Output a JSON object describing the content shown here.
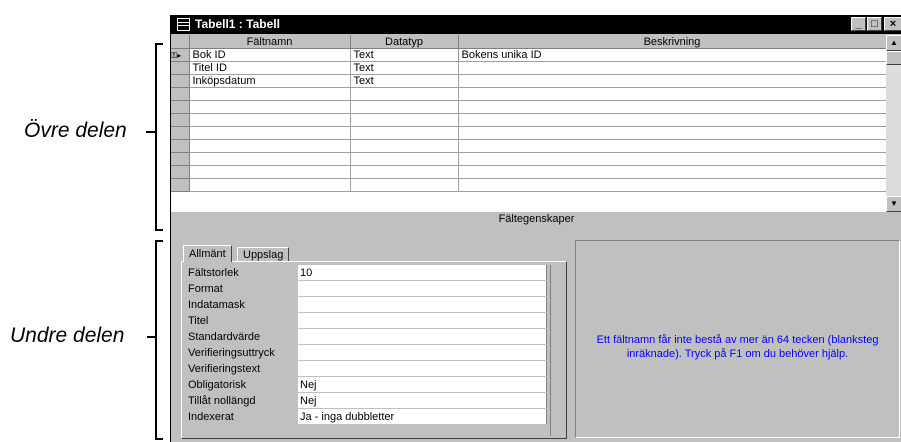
{
  "annotations": {
    "upper_label": "Övre delen",
    "lower_label": "Undre delen"
  },
  "window": {
    "title": "Tabell1 : Tabell",
    "title_icon": "table-icon",
    "minimize": "_",
    "maximize": "□",
    "close": "×"
  },
  "grid": {
    "columns": [
      "Fältnamn",
      "Datatyp",
      "Beskrivning"
    ],
    "rows": [
      {
        "name": "Bok ID",
        "type": "Text",
        "desc": "Bokens unika ID",
        "primary_key": true,
        "current": true
      },
      {
        "name": "Titel ID",
        "type": "Text",
        "desc": ""
      },
      {
        "name": "Inköpsdatum",
        "type": "Text",
        "desc": ""
      },
      {
        "name": "",
        "type": "",
        "desc": ""
      },
      {
        "name": "",
        "type": "",
        "desc": ""
      },
      {
        "name": "",
        "type": "",
        "desc": ""
      },
      {
        "name": "",
        "type": "",
        "desc": ""
      },
      {
        "name": "",
        "type": "",
        "desc": ""
      },
      {
        "name": "",
        "type": "",
        "desc": ""
      },
      {
        "name": "",
        "type": "",
        "desc": ""
      },
      {
        "name": "",
        "type": "",
        "desc": ""
      }
    ]
  },
  "properties_section_label": "Fältegenskaper",
  "tabs": [
    "Allmänt",
    "Uppslag"
  ],
  "properties": [
    {
      "label": "Fältstorlek",
      "value": "10"
    },
    {
      "label": "Format",
      "value": ""
    },
    {
      "label": "Indatamask",
      "value": ""
    },
    {
      "label": "Titel",
      "value": ""
    },
    {
      "label": "Standardvärde",
      "value": ""
    },
    {
      "label": "Verifieringsuttryck",
      "value": ""
    },
    {
      "label": "Verifieringstext",
      "value": ""
    },
    {
      "label": "Obligatorisk",
      "value": "Nej"
    },
    {
      "label": "Tillåt nollängd",
      "value": "Nej"
    },
    {
      "label": "Indexerat",
      "value": "Ja - inga dubbletter"
    }
  ],
  "help_text": "Ett fältnamn får inte bestå av mer än 64 tecken (blanksteg inräknade). Tryck på F1 om du behöver hjälp.",
  "colors": {
    "help_text": "#0000ff",
    "titlebar": "#000000",
    "face": "#c0c0c0"
  }
}
